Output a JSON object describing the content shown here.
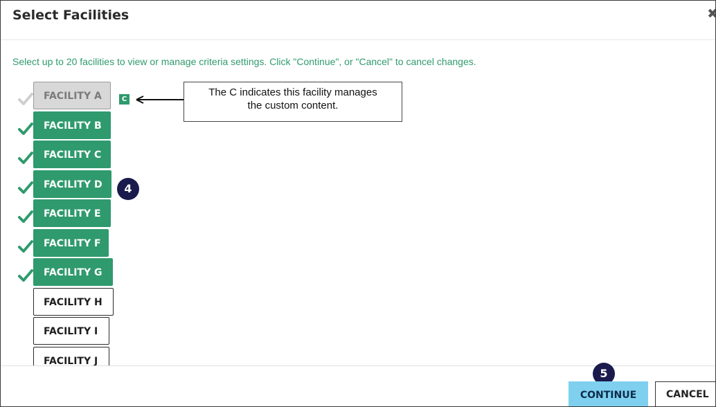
{
  "dialog": {
    "title": "Select Facilities",
    "close_icon": "close-icon",
    "instruction": "Select up to 20 facilities to view or manage criteria settings. Click \"Continue\", or \"Cancel\" to cancel changes."
  },
  "facilities": [
    {
      "label": "FACILITY A",
      "state": "disabled",
      "checked": true,
      "custom_badge": "C"
    },
    {
      "label": "FACILITY B",
      "state": "selected",
      "checked": true
    },
    {
      "label": "FACILITY C",
      "state": "selected",
      "checked": true
    },
    {
      "label": "FACILITY D",
      "state": "selected",
      "checked": true
    },
    {
      "label": "FACILITY E",
      "state": "selected",
      "checked": true
    },
    {
      "label": "FACILITY F",
      "state": "selected",
      "checked": true
    },
    {
      "label": "FACILITY G",
      "state": "selected",
      "checked": true
    },
    {
      "label": "FACILITY H",
      "state": "unselected",
      "checked": false
    },
    {
      "label": "FACILITY I",
      "state": "unselected",
      "checked": false
    },
    {
      "label": "FACILITY J",
      "state": "unselected",
      "checked": false
    }
  ],
  "callout": {
    "line1": "The C indicates this facility manages",
    "line2": "the custom content."
  },
  "step_badges": {
    "facility_step": "4",
    "continue_step": "5"
  },
  "footer": {
    "continue_label": "CONTINUE",
    "cancel_label": "CANCEL"
  },
  "colors": {
    "accent_green": "#2f9a6d",
    "continue_blue": "#7fd0ef",
    "badge_navy": "#1a1a4d",
    "check_gray": "#cfcfcf"
  }
}
